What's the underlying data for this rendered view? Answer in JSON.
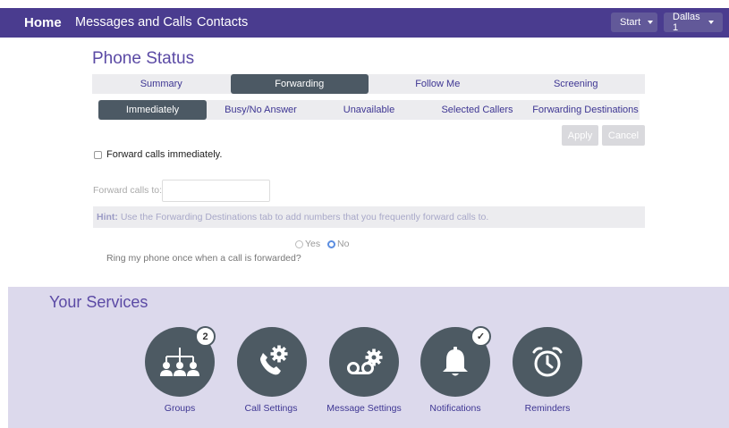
{
  "nav": {
    "home": "Home",
    "messages": "Messages and Calls",
    "contacts": "Contacts",
    "start": "Start",
    "location": "Dallas 1"
  },
  "page_title": "Phone Status",
  "tabs": [
    "Summary",
    "Forwarding",
    "Follow Me",
    "Screening"
  ],
  "active_tab": "Forwarding",
  "subtabs": [
    "Immediately",
    "Busy/No Answer",
    "Unavailable",
    "Selected Callers",
    "Forwarding Destinations"
  ],
  "active_subtab": "Immediately",
  "buttons": {
    "apply": "Apply",
    "cancel": "Cancel"
  },
  "form": {
    "forward_checkbox_label": "Forward calls immediately.",
    "forward_checked": false,
    "forward_to_label": "Forward calls to:",
    "forward_to_value": "",
    "hint_label": "Hint:",
    "hint_text": "Use the Forwarding Destinations tab to add numbers that you frequently forward calls to.",
    "ring_question": "Ring my phone once when a call is forwarded?",
    "yes_label": "Yes",
    "no_label": "No",
    "ring_selected": "No"
  },
  "services": {
    "title": "Your Services",
    "items": [
      {
        "label": "Groups",
        "icon": "groups-icon",
        "badge": "2"
      },
      {
        "label": "Call Settings",
        "icon": "call-settings-icon"
      },
      {
        "label": "Message Settings",
        "icon": "voicemail-settings-icon"
      },
      {
        "label": "Notifications",
        "icon": "bell-icon",
        "badge": "✓"
      },
      {
        "label": "Reminders",
        "icon": "alarm-clock-icon"
      }
    ]
  }
}
